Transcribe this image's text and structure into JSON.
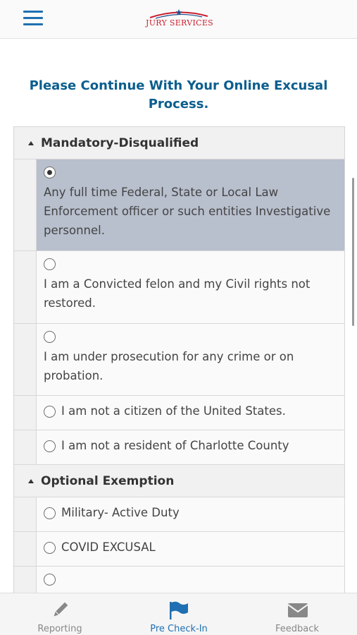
{
  "header": {
    "logo_text": "JURY SERVICES",
    "logo_icon": "flag-swoosh-star"
  },
  "heading": "Please Continue With Your Online Excusal Process.",
  "sections": [
    {
      "title": "Mandatory-Disqualified",
      "options": [
        {
          "label": "Any full time Federal, State or Local Law Enforcement officer or such entities Investigative personnel.",
          "selected": true
        },
        {
          "label": "I am a Convicted felon and my Civil rights not restored.",
          "selected": false
        },
        {
          "label": "I am under prosecution for any crime or on probation.",
          "selected": false
        },
        {
          "label": "I am not a citizen of the United States.",
          "selected": false
        },
        {
          "label": "I am not a resident of Charlotte County",
          "selected": false
        }
      ]
    },
    {
      "title": "Optional Exemption",
      "options": [
        {
          "label": "Military- Active Duty",
          "selected": false
        },
        {
          "label": "COVID EXCUSAL",
          "selected": false
        },
        {
          "label": "",
          "selected": false
        }
      ]
    }
  ],
  "tabs": [
    {
      "label": "Reporting",
      "icon": "pencil-icon",
      "active": false
    },
    {
      "label": "Pre Check-In",
      "icon": "flag-icon",
      "active": true
    },
    {
      "label": "Feedback",
      "icon": "envelope-icon",
      "active": false
    }
  ],
  "colors": {
    "accent": "#1f6fb2",
    "heading": "#0b5e8e",
    "selected_row": "#b8bfcd",
    "logo_red": "#c8202f"
  }
}
